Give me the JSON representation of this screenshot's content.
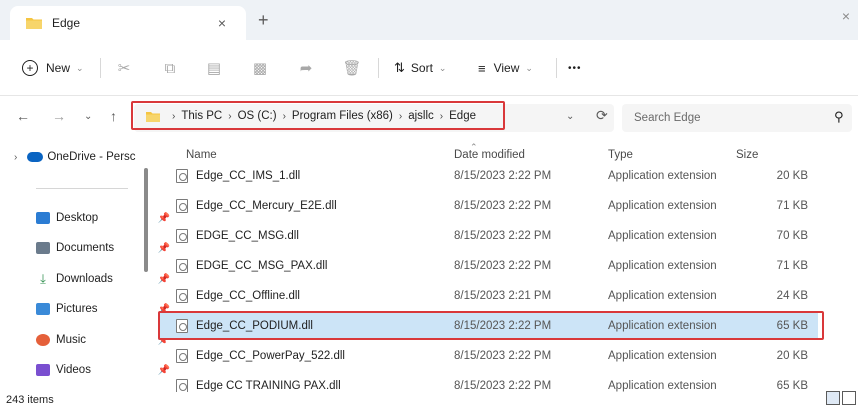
{
  "tab": {
    "title": "Edge",
    "close": "×",
    "new_tab": "+"
  },
  "window": {
    "close": "×"
  },
  "commands": {
    "new_label": "New",
    "sort_label": "Sort",
    "view_label": "View",
    "more": "•••",
    "icons": [
      "cut-icon",
      "copy-icon",
      "paste-icon",
      "rename-icon",
      "share-icon",
      "delete-icon"
    ]
  },
  "address": {
    "crumbs": [
      "This PC",
      "OS (C:)",
      "Program Files (x86)",
      "ajsllc",
      "Edge"
    ],
    "search_placeholder": "Search Edge"
  },
  "sidebar": {
    "onedrive": "OneDrive - Persc",
    "items": [
      {
        "label": "Desktop",
        "color": "#2b7cd3"
      },
      {
        "label": "Documents",
        "color": "#6b7b8c"
      },
      {
        "label": "Downloads",
        "color": "#2f8f4e"
      },
      {
        "label": "Pictures",
        "color": "#3a8ad8"
      },
      {
        "label": "Music",
        "color": "#e5603a"
      },
      {
        "label": "Videos",
        "color": "#7a4fd0"
      }
    ]
  },
  "columns": {
    "name": "Name",
    "date": "Date modified",
    "type": "Type",
    "size": "Size"
  },
  "files": [
    {
      "name": "Edge_CC_IMS_1.dll",
      "date": "8/15/2023 2:22 PM",
      "type": "Application extension",
      "size": "20 KB"
    },
    {
      "name": "Edge_CC_Mercury_E2E.dll",
      "date": "8/15/2023 2:22 PM",
      "type": "Application extension",
      "size": "71 KB"
    },
    {
      "name": "EDGE_CC_MSG.dll",
      "date": "8/15/2023 2:22 PM",
      "type": "Application extension",
      "size": "70 KB"
    },
    {
      "name": "EDGE_CC_MSG_PAX.dll",
      "date": "8/15/2023 2:22 PM",
      "type": "Application extension",
      "size": "71 KB"
    },
    {
      "name": "Edge_CC_Offline.dll",
      "date": "8/15/2023 2:21 PM",
      "type": "Application extension",
      "size": "24 KB"
    },
    {
      "name": "Edge_CC_PODIUM.dll",
      "date": "8/15/2023 2:22 PM",
      "type": "Application extension",
      "size": "65 KB"
    },
    {
      "name": "Edge_CC_PowerPay_522.dll",
      "date": "8/15/2023 2:22 PM",
      "type": "Application extension",
      "size": "20 KB"
    },
    {
      "name": "Edge CC TRAINING PAX.dll",
      "date": "8/15/2023 2:22 PM",
      "type": "Application extension",
      "size": "65 KB"
    }
  ],
  "status": {
    "count": "243 items"
  },
  "colors": {
    "accent": "#d9383a",
    "selection": "#cce4f7",
    "folder": "#f5c542"
  }
}
